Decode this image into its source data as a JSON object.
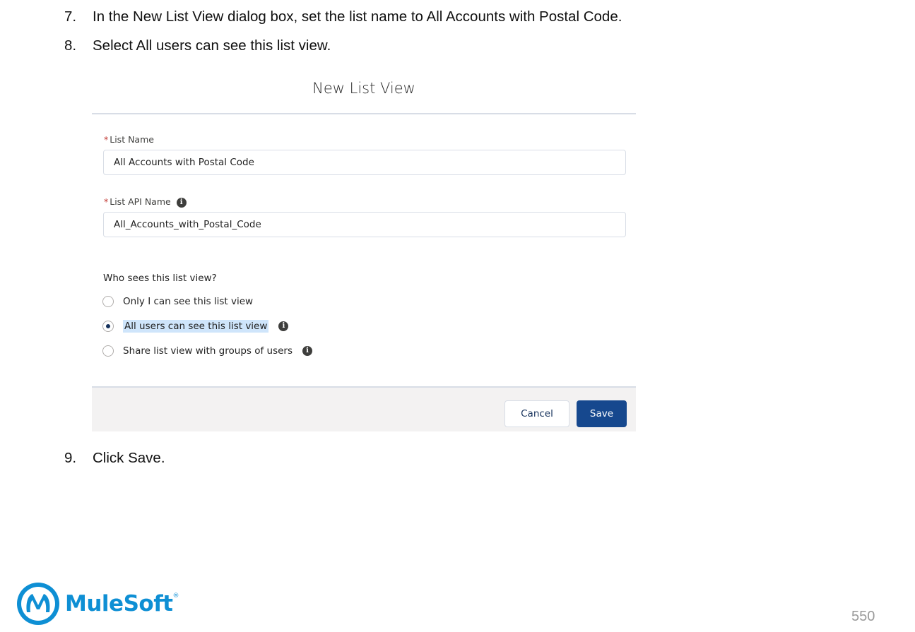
{
  "steps": {
    "step7": {
      "num": "7.",
      "text": "In the New List View dialog box, set the list name to All Accounts with Postal Code."
    },
    "step8": {
      "num": "8.",
      "text": "Select All users can see this list view."
    },
    "step9": {
      "num": "9.",
      "text": "Click Save."
    }
  },
  "dialog": {
    "title": "New List View",
    "required_mark": "*",
    "list_name_label": "List Name",
    "list_name_value": "All Accounts with Postal Code",
    "api_name_label": "List API Name",
    "api_name_value": "All_Accounts_with_Postal_Code",
    "who_sees_label": "Who sees this list view?",
    "options": [
      {
        "label": "Only I can see this list view",
        "selected": false
      },
      {
        "label": "All users can see this list view",
        "selected": true
      },
      {
        "label": "Share list view with groups of users",
        "selected": false
      }
    ],
    "cancel_label": "Cancel",
    "save_label": "Save",
    "info_glyph": "i"
  },
  "footer": {
    "logo_text": "MuleSoft",
    "logo_mark": "®",
    "page_number": "550"
  }
}
